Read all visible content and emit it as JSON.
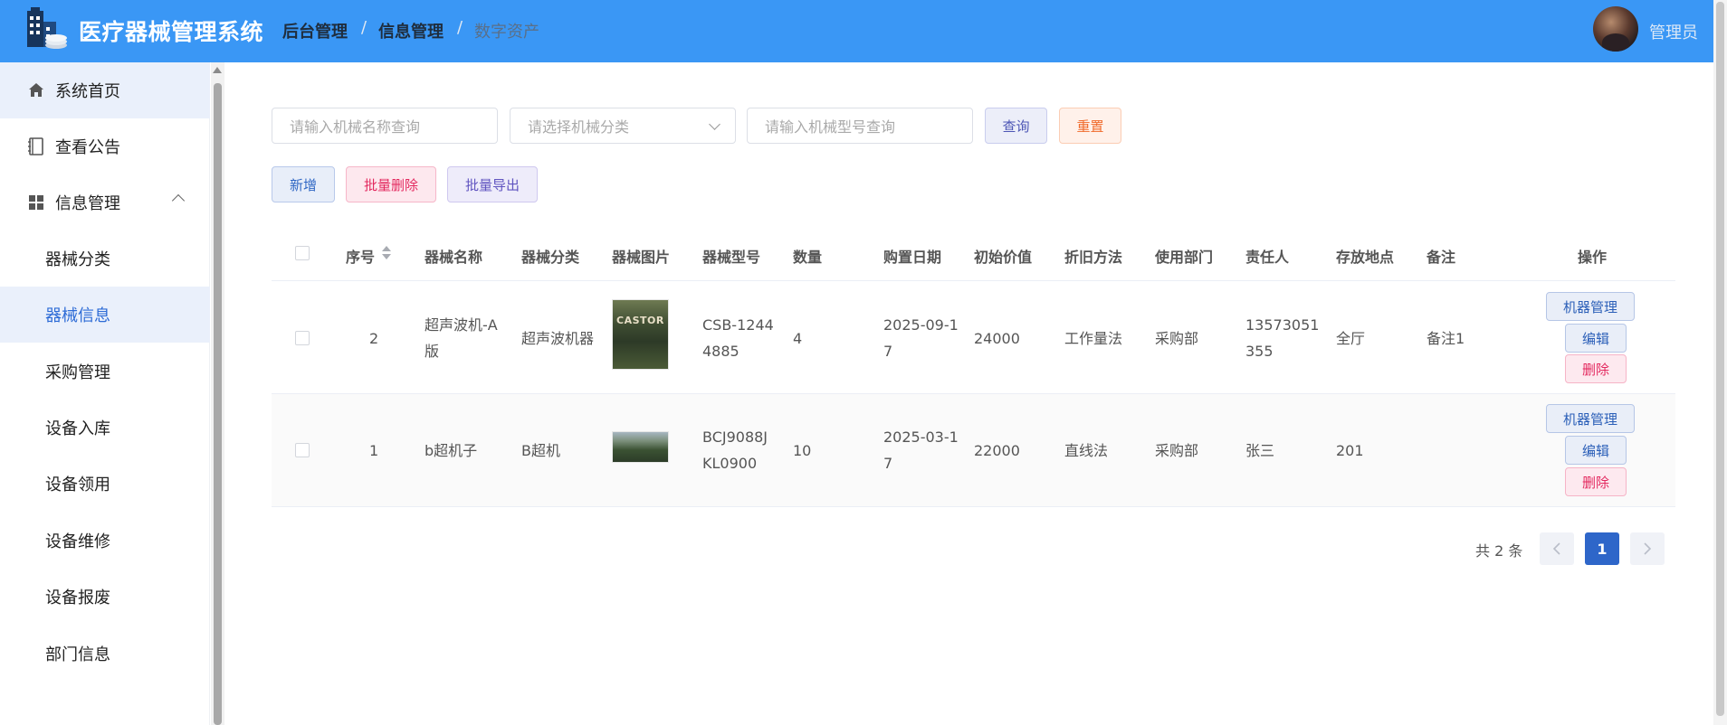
{
  "header": {
    "app_title": "医疗器械管理系统",
    "breadcrumbs": [
      "后台管理",
      "信息管理",
      "数字资产"
    ],
    "username": "管理员",
    "brand_color": "#3a97f5"
  },
  "sidebar": {
    "items": [
      {
        "label": "系统首页",
        "icon": "home-icon"
      },
      {
        "label": "查看公告",
        "icon": "notice-icon"
      },
      {
        "label": "信息管理",
        "icon": "grid-icon"
      }
    ],
    "sub_items": [
      {
        "label": "器械分类"
      },
      {
        "label": "器械信息"
      },
      {
        "label": "采购管理"
      },
      {
        "label": "设备入库"
      },
      {
        "label": "设备领用"
      },
      {
        "label": "设备维修"
      },
      {
        "label": "设备报废"
      },
      {
        "label": "部门信息"
      }
    ]
  },
  "search": {
    "name_placeholder": "请输入机械名称查询",
    "category_placeholder": "请选择机械分类",
    "model_placeholder": "请输入机械型号查询",
    "query_label": "查询",
    "reset_label": "重置"
  },
  "toolbar": {
    "add_label": "新增",
    "batch_delete_label": "批量删除",
    "batch_export_label": "批量导出"
  },
  "table": {
    "headers": [
      "序号",
      "器械名称",
      "器械分类",
      "器械图片",
      "器械型号",
      "数量",
      "购置日期",
      "初始价值",
      "折旧方法",
      "使用部门",
      "责任人",
      "存放地点",
      "备注",
      "操作"
    ],
    "rows": [
      {
        "id": "2",
        "name": [
          "超声波机-A",
          "版"
        ],
        "category": "超声波机器",
        "image_text": "CASTOR",
        "model": [
          "CSB-1244",
          "4885"
        ],
        "quantity": "4",
        "date": [
          "2025-09-1",
          "7"
        ],
        "value": "24000",
        "depreciation": "工作量法",
        "dept": "采购部",
        "person": [
          "13573051",
          "355"
        ],
        "location": "全厅",
        "remark": "备注1"
      },
      {
        "id": "1",
        "name": [
          "b超机子"
        ],
        "category": "B超机",
        "image_text": "",
        "model": [
          "BCJ9088J",
          "KL0900"
        ],
        "quantity": "10",
        "date": [
          "2025-03-1",
          "7"
        ],
        "value": "22000",
        "depreciation": "直线法",
        "dept": "采购部",
        "person": [
          "张三"
        ],
        "location": "201",
        "remark": ""
      }
    ],
    "ops": {
      "machine_label": "机器管理",
      "edit_label": "编辑",
      "delete_label": "删除"
    }
  },
  "pagination": {
    "total_text": "共 2 条",
    "current_page": "1",
    "prev_icon": "chevron-left-icon",
    "next_icon": "chevron-right-icon"
  }
}
